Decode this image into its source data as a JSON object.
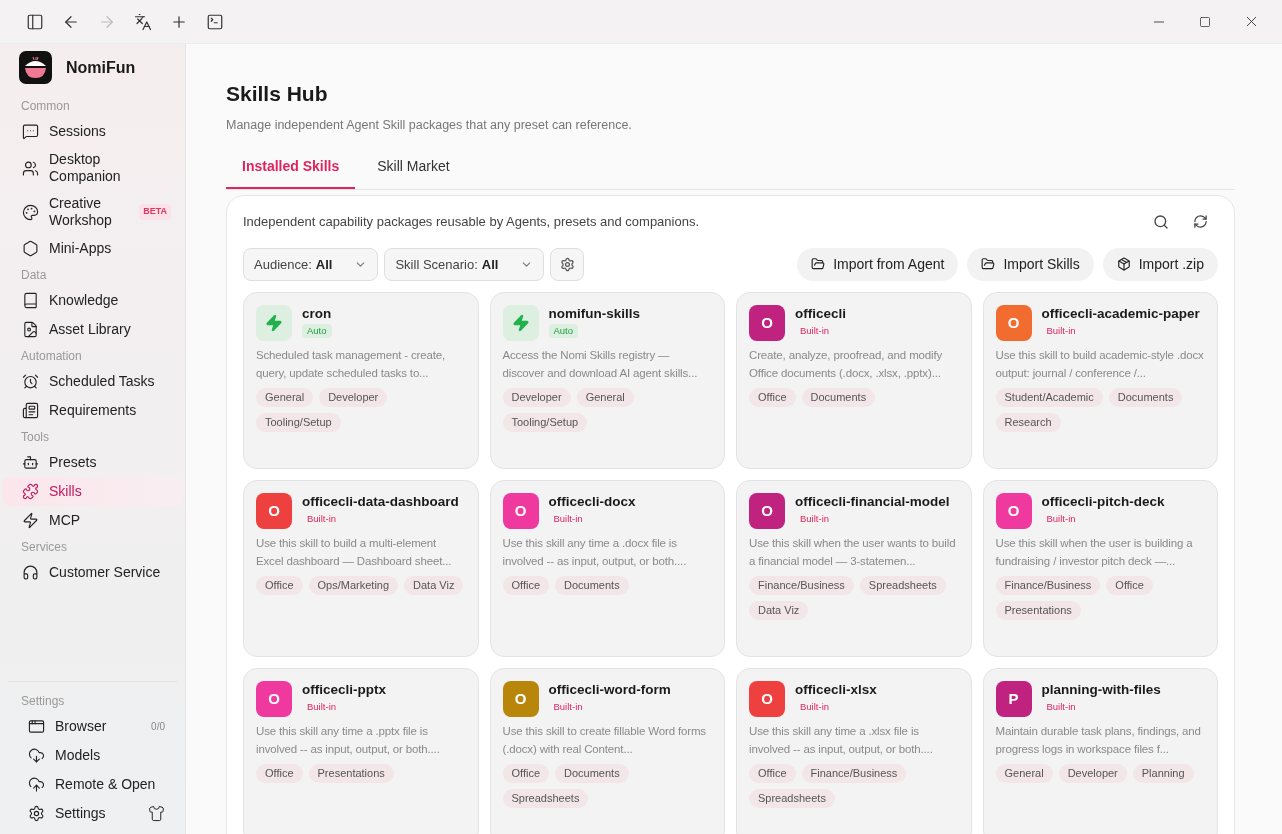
{
  "app": {
    "name": "NomiFun"
  },
  "sidebar": {
    "sections": [
      {
        "title": "Common",
        "items": [
          {
            "label": "Sessions",
            "selected": false
          },
          {
            "label": "Desktop Companion",
            "selected": false
          },
          {
            "label": "Creative Workshop",
            "badge": "BETA",
            "selected": false
          },
          {
            "label": "Mini-Apps",
            "selected": false
          }
        ]
      },
      {
        "title": "Data",
        "items": [
          {
            "label": "Knowledge",
            "selected": false
          },
          {
            "label": "Asset Library",
            "selected": false
          }
        ]
      },
      {
        "title": "Automation",
        "items": [
          {
            "label": "Scheduled Tasks",
            "selected": false
          },
          {
            "label": "Requirements",
            "selected": false
          }
        ]
      },
      {
        "title": "Tools",
        "items": [
          {
            "label": "Presets",
            "selected": false
          },
          {
            "label": "Skills",
            "selected": true
          },
          {
            "label": "MCP",
            "selected": false
          }
        ]
      },
      {
        "title": "Services",
        "items": [
          {
            "label": "Customer Service",
            "selected": false
          }
        ]
      }
    ],
    "footer": {
      "title": "Settings",
      "items": [
        {
          "label": "Browser",
          "count": "0/0",
          "selected": false
        },
        {
          "label": "Models",
          "selected": false
        },
        {
          "label": "Remote & Open",
          "selected": false
        },
        {
          "label": "Settings",
          "selected": false
        }
      ]
    }
  },
  "page": {
    "title": "Skills Hub",
    "subtitle": "Manage independent Agent Skill packages that any preset can reference.",
    "tabs": [
      {
        "label": "Installed Skills",
        "selected": true
      },
      {
        "label": "Skill Market",
        "selected": false
      }
    ],
    "panel_description": "Independent capability packages reusable by Agents, presets and companions.",
    "filters": [
      {
        "label": "Audience:",
        "value": "All"
      },
      {
        "label": "Skill Scenario:",
        "value": "All"
      }
    ],
    "actions": [
      "Import from Agent",
      "Import Skills",
      "Import .zip"
    ],
    "skills": [
      {
        "name": "cron",
        "icon": {
          "kind": "auto"
        },
        "badge": {
          "kind": "auto",
          "label": "Auto"
        },
        "description": "Scheduled task management - create, query, update scheduled tasks to...",
        "tags": [
          "General",
          "Developer",
          "Tooling/Setup"
        ]
      },
      {
        "name": "nomifun-skills",
        "icon": {
          "kind": "auto"
        },
        "badge": {
          "kind": "auto",
          "label": "Auto"
        },
        "description": "Access the Nomi Skills registry — discover and download AI agent skills...",
        "tags": [
          "Developer",
          "General",
          "Tooling/Setup"
        ]
      },
      {
        "name": "officecli",
        "icon": {
          "kind": "letter",
          "letter": "O",
          "color": "#c0227f"
        },
        "badge": {
          "kind": "builtin",
          "label": "Built-in"
        },
        "description": "Create, analyze, proofread, and modify Office documents (.docx, .xlsx, .pptx)...",
        "tags": [
          "Office",
          "Documents"
        ]
      },
      {
        "name": "officecli-academic-paper",
        "icon": {
          "kind": "letter",
          "letter": "O",
          "color": "#f26b2f"
        },
        "badge": {
          "kind": "builtin",
          "label": "Built-in"
        },
        "description": "Use this skill to build academic-style .docx output: journal / conference /...",
        "tags": [
          "Student/Academic",
          "Documents",
          "Research"
        ]
      },
      {
        "name": "officecli-data-dashboard",
        "icon": {
          "kind": "letter",
          "letter": "O",
          "color": "#ef4040"
        },
        "badge": {
          "kind": "builtin",
          "label": "Built-in"
        },
        "description": "Use this skill to build a multi-element Excel dashboard — Dashboard sheet...",
        "tags": [
          "Office",
          "Ops/Marketing",
          "Data Viz"
        ]
      },
      {
        "name": "officecli-docx",
        "icon": {
          "kind": "letter",
          "letter": "O",
          "color": "#f0399e"
        },
        "badge": {
          "kind": "builtin",
          "label": "Built-in"
        },
        "description": "Use this skill any time a .docx file is involved -- as input, output, or both....",
        "tags": [
          "Office",
          "Documents"
        ]
      },
      {
        "name": "officecli-financial-model",
        "icon": {
          "kind": "letter",
          "letter": "O",
          "color": "#c0227f"
        },
        "badge": {
          "kind": "builtin",
          "label": "Built-in"
        },
        "description": "Use this skill when the user wants to build a financial model — 3-statemen...",
        "tags": [
          "Finance/Business",
          "Spreadsheets",
          "Data Viz"
        ]
      },
      {
        "name": "officecli-pitch-deck",
        "icon": {
          "kind": "letter",
          "letter": "O",
          "color": "#f0399e"
        },
        "badge": {
          "kind": "builtin",
          "label": "Built-in"
        },
        "description": "Use this skill when the user is building a fundraising / investor pitch deck —...",
        "tags": [
          "Finance/Business",
          "Office",
          "Presentations"
        ]
      },
      {
        "name": "officecli-pptx",
        "icon": {
          "kind": "letter",
          "letter": "O",
          "color": "#f0399e"
        },
        "badge": {
          "kind": "builtin",
          "label": "Built-in"
        },
        "description": "Use this skill any time a .pptx file is involved -- as input, output, or both....",
        "tags": [
          "Office",
          "Presentations"
        ]
      },
      {
        "name": "officecli-word-form",
        "icon": {
          "kind": "letter",
          "letter": "O",
          "color": "#b8860b"
        },
        "badge": {
          "kind": "builtin",
          "label": "Built-in"
        },
        "description": "Use this skill to create fillable Word forms (.docx) with real Content...",
        "tags": [
          "Office",
          "Documents",
          "Spreadsheets"
        ]
      },
      {
        "name": "officecli-xlsx",
        "icon": {
          "kind": "letter",
          "letter": "O",
          "color": "#ef4040"
        },
        "badge": {
          "kind": "builtin",
          "label": "Built-in"
        },
        "description": "Use this skill any time a .xlsx file is involved -- as input, output, or both....",
        "tags": [
          "Office",
          "Finance/Business",
          "Spreadsheets"
        ]
      },
      {
        "name": "planning-with-files",
        "icon": {
          "kind": "letter",
          "letter": "P",
          "color": "#c0227f"
        },
        "badge": {
          "kind": "builtin",
          "label": "Built-in"
        },
        "description": "Maintain durable task plans, findings, and progress logs in workspace files f...",
        "tags": [
          "General",
          "Developer",
          "Planning"
        ]
      }
    ]
  }
}
